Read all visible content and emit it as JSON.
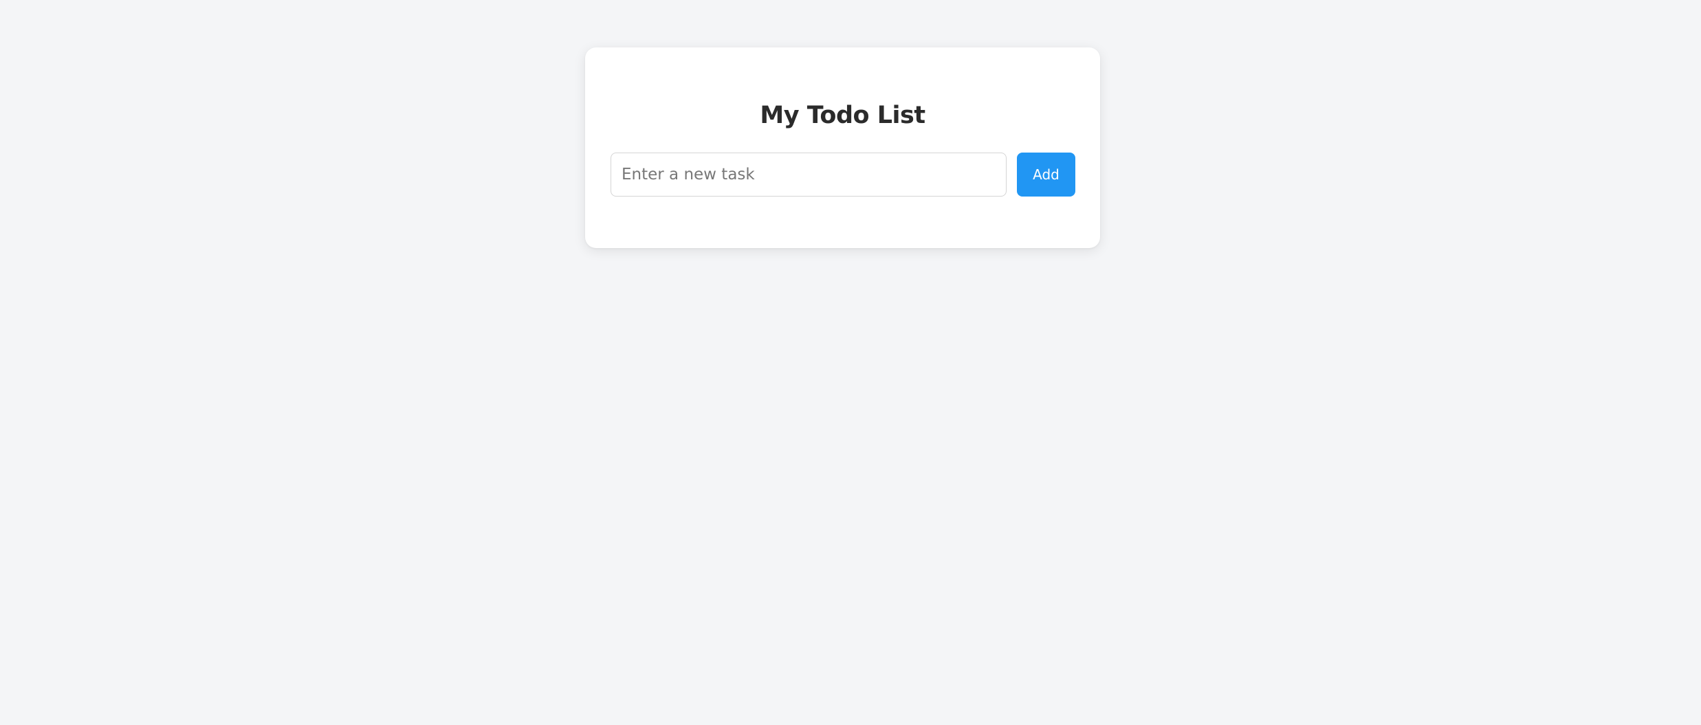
{
  "todo": {
    "title": "My Todo List",
    "input": {
      "value": "",
      "placeholder": "Enter a new task"
    },
    "add_label": "Add"
  },
  "colors": {
    "page_background": "#f4f5f7",
    "card_background": "#ffffff",
    "accent": "#2196f3",
    "title_text": "#2b2b2b",
    "placeholder_text": "#777777"
  }
}
